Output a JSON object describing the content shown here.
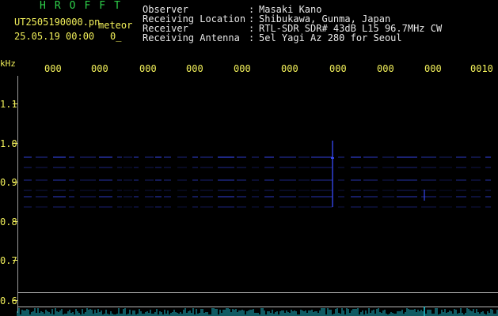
{
  "header": {
    "app_title": "HROFFT",
    "filename": "UT2505190000.pn",
    "mode_label": "meteor",
    "datetime": "25.05.19 00:00",
    "count_value": "0_"
  },
  "meta": {
    "rows": [
      {
        "label": "Observer",
        "value": "Masaki Kano"
      },
      {
        "label": "Receiving Location",
        "value": "Shibukawa, Gunma, Japan"
      },
      {
        "label": "Receiver",
        "value": "RTL-SDR SDR# 43dB L15 96.7MHz CW"
      },
      {
        "label": "Receiving Antenna",
        "value": "5el Yagi Az 280 for Seoul"
      }
    ]
  },
  "axes": {
    "y_unit": "kHz",
    "x_ticks": [
      "000",
      "000",
      "000",
      "000",
      "000",
      "000",
      "000",
      "000",
      "000",
      "0010"
    ],
    "y_ticks": [
      "1.1",
      "1.0",
      "0.9",
      "0.8",
      "0.7",
      "0.6"
    ]
  },
  "colors": {
    "text_yellow": "#f2f05a",
    "title_green": "#2ed04a",
    "signal_blue": "#3a4cff",
    "spectrum_cyan": "#26d4e6"
  }
}
